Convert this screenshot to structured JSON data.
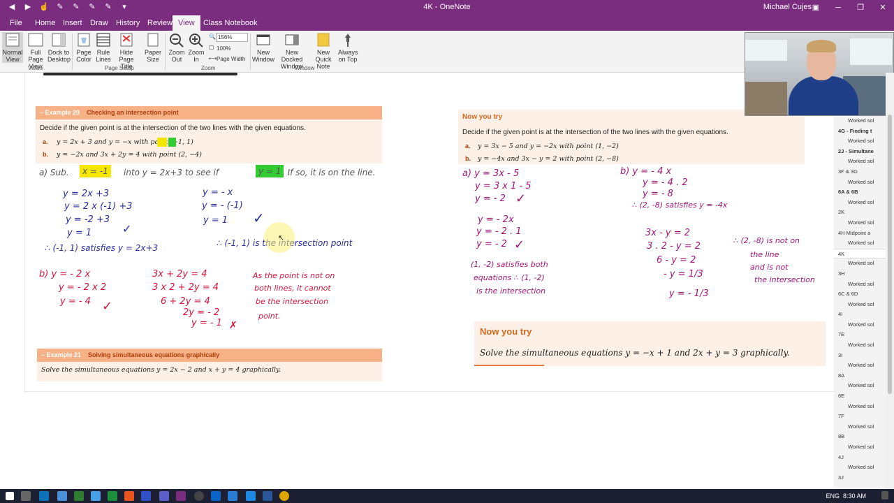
{
  "window": {
    "title": "4K - OneNote",
    "user": "Michael Cujes"
  },
  "tabs": [
    "File",
    "Home",
    "Insert",
    "Draw",
    "History",
    "Review",
    "View",
    "Class Notebook"
  ],
  "ribbon": {
    "views": {
      "normal": "Normal View",
      "fullpage": "Full Page View",
      "dock": "Dock to Desktop",
      "label": "Views"
    },
    "pagesetup": {
      "color": "Page Color",
      "rule": "Rule Lines",
      "hide": "Hide Page Title",
      "paper": "Paper Size",
      "label": "Page Setup"
    },
    "zoom": {
      "out": "Zoom Out",
      "in": "Zoom In",
      "value": "156%",
      "hundred": "100%",
      "width": "Page Width",
      "label": "Zoom"
    },
    "window": {
      "new": "New Window",
      "docked": "New Docked Window",
      "quick": "New Quick Note",
      "ontop": "Always on Top",
      "label": "Window"
    }
  },
  "example20": {
    "number": "– Example 20",
    "title": "Checking an intersection point",
    "prompt": "Decide if the given point is at the intersection of the two lines with the given equations.",
    "a_label": "a.",
    "a_text": "y = 2x + 3 and y = −x with point (−1, 1)",
    "b_label": "b.",
    "b_text": "y = −2x and 3x + 2y = 4 with point (2, −4)"
  },
  "example21": {
    "number": "– Example 21",
    "title": "Solving simultaneous equations graphically",
    "text": "Solve the simultaneous equations y = 2x − 2 and x + y = 4 graphically."
  },
  "nyt1": {
    "head": "Now you try",
    "prompt": "Decide if the given point is at the intersection of the two lines with the given equations.",
    "a_label": "a.",
    "a_text": "y = 3x − 5 and y = −2x with point (1, −2)",
    "b_label": "b.",
    "b_text": "y = −4x and 3x − y = 2 with point (2, −8)"
  },
  "nyt2": {
    "head": "Now you try",
    "text": "Solve the simultaneous equations y = −x + 1 and 2x + y = 3 graphically."
  },
  "handwriting": {
    "sub_a": "a) Sub.",
    "x_hl": "x = -1",
    "into": "into  y = 2x+3  to see if",
    "y_hl": "y = 1",
    "ifso": ". If so, it is on the line.",
    "col1": [
      "y = 2x +3",
      "y = 2 x (-1) +3",
      "y = -2 +3",
      "y = 1"
    ],
    "col2": [
      "y = - x",
      "y = - (-1)",
      "y = 1"
    ],
    "sat1": "∴ (-1, 1) satisfies y = 2x+3",
    "sat2": "∴ (-1, 1) is the intersection point",
    "b_col1": [
      "b)  y = - 2 x",
      "y = - 2 x 2",
      "y = - 4"
    ],
    "b_col2": [
      "3x + 2y = 4",
      "3 x 2 + 2y = 4",
      "6 + 2y = 4",
      "2y = - 2",
      "y = - 1"
    ],
    "b_note": [
      "As the point is not on",
      "both lines, it cannot",
      "be the intersection",
      "point."
    ],
    "r_a": [
      "a)  y = 3x - 5",
      "y = 3 x 1 - 5",
      "y = - 2"
    ],
    "r_a2": [
      "y = - 2x",
      "y = - 2 . 1",
      "y = - 2"
    ],
    "r_a_sat": [
      "(1, -2) satisfies both",
      "equations ∴ (1, -2)",
      "is the intersection"
    ],
    "r_b": [
      "b)  y = - 4 x",
      "y = - 4 . 2",
      "y = - 8"
    ],
    "r_b_sat": "∴ (2, -8) satisfies y = -4x",
    "r_b2": [
      "3x - y = 2",
      "3 . 2 - y = 2",
      "6 - y = 2",
      "- y = 1/3",
      "y = - 1/3"
    ],
    "r_b_note": [
      "∴ (2, -8) is not on",
      "the line",
      "and is not",
      "the intersection"
    ]
  },
  "sections": [
    {
      "label": "Worked sol",
      "sub": true
    },
    {
      "label": "4G - Finding t",
      "bold": true
    },
    {
      "label": "Worked sol",
      "sub": true
    },
    {
      "label": "2J - Simultane",
      "bold": true
    },
    {
      "label": "Worked sol",
      "sub": true
    },
    {
      "label": "3F & 3G"
    },
    {
      "label": "Worked sol",
      "sub": true
    },
    {
      "label": "6A & 6B",
      "bold": true
    },
    {
      "label": "Worked sol",
      "sub": true
    },
    {
      "label": "2K"
    },
    {
      "label": "Worked sol",
      "sub": true
    },
    {
      "label": "4H Midpoint a"
    },
    {
      "label": "Worked sol",
      "sub": true
    },
    {
      "label": "4K",
      "selected": true
    },
    {
      "label": "Worked sol",
      "sub": true
    },
    {
      "label": "3H"
    },
    {
      "label": "Worked sol",
      "sub": true
    },
    {
      "label": "6C & 6D"
    },
    {
      "label": "Worked sol",
      "sub": true
    },
    {
      "label": "4I"
    },
    {
      "label": "Worked sol",
      "sub": true
    },
    {
      "label": "7E"
    },
    {
      "label": "Worked sol",
      "sub": true
    },
    {
      "label": "3I"
    },
    {
      "label": "Worked sol",
      "sub": true
    },
    {
      "label": "8A"
    },
    {
      "label": "Worked sol",
      "sub": true
    },
    {
      "label": "6E"
    },
    {
      "label": "Worked sol",
      "sub": true
    },
    {
      "label": "7F"
    },
    {
      "label": "Worked sol",
      "sub": true
    },
    {
      "label": "8B"
    },
    {
      "label": "Worked sol",
      "sub": true
    },
    {
      "label": "4J"
    },
    {
      "label": "Worked sol",
      "sub": true
    },
    {
      "label": "3J"
    }
  ],
  "taskbar": {
    "lang": "ENG",
    "time": "8:30 AM"
  },
  "colors": {
    "onenote": "#7a2c7e",
    "example_head": "#f6b187",
    "example_body": "#fdf1e7",
    "blue_ink": "#2b2f9c",
    "red_ink": "#d4143c",
    "purple_ink": "#a1157a"
  }
}
